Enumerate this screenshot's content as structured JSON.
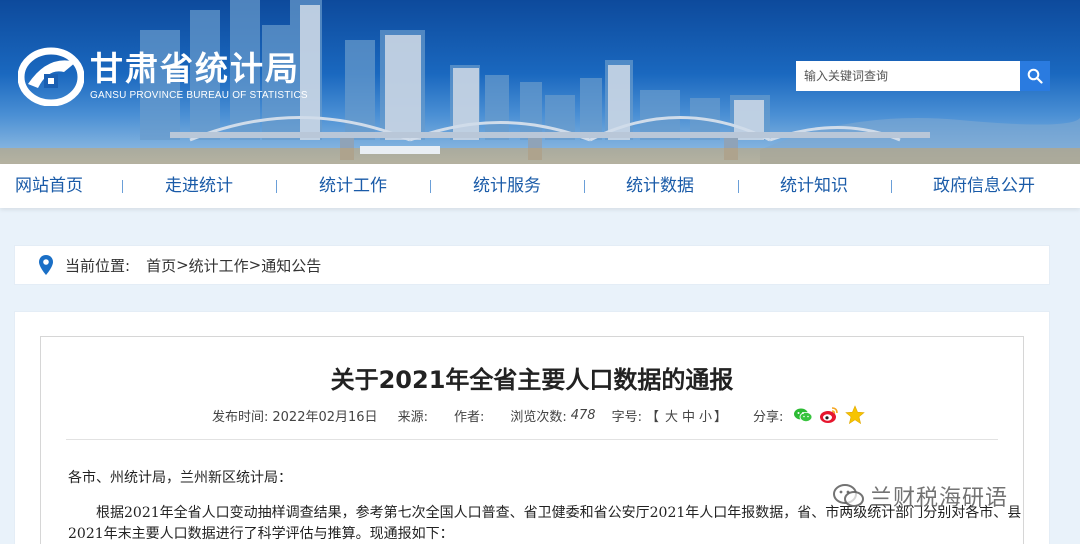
{
  "site": {
    "name_cn": "甘肃省统计局",
    "name_en": "GANSU PROVINCE BUREAU OF STATISTICS",
    "logo_icon": "gansu-stats-logo"
  },
  "search": {
    "placeholder": "输入关键词查询",
    "icon": "search-icon"
  },
  "nav": {
    "items": [
      {
        "label": "网站首页"
      },
      {
        "label": "走进统计"
      },
      {
        "label": "统计工作"
      },
      {
        "label": "统计服务"
      },
      {
        "label": "统计数据"
      },
      {
        "label": "统计知识"
      },
      {
        "label": "政府信息公开"
      }
    ],
    "separator": "|"
  },
  "breadcrumb": {
    "prefix": "当前位置:",
    "items": [
      "首页",
      "统计工作",
      "通知公告"
    ],
    "separator": ">"
  },
  "article": {
    "title": "关于2021年全省主要人口数据的通报",
    "meta": {
      "date_label": "发布时间:",
      "date_value": "2022年02月16日",
      "source_label": "来源:",
      "author_label": "作者:",
      "views_label": "浏览次数:",
      "views_value": "478",
      "font_label": "字号:",
      "font_open": "【",
      "font_large": "大",
      "font_medium": "中",
      "font_small": "小",
      "font_close": "】",
      "share_label": "分享:"
    },
    "paragraph1": "各市、州统计局，兰州新区统计局：",
    "paragraph2": "根据2021年全省人口变动抽样调查结果，参考第七次全国人口普查、省卫健委和省公安厅2021年人口年报数据，省、市两级统计部门分别对各市、县",
    "paragraph3": "2021年末主要人口数据进行了科学评估与推算。现通报如下："
  },
  "watermark": {
    "text": "兰财税海研语"
  },
  "colors": {
    "nav_text": "#1a5ba8",
    "banner_top": "#0d4a9c",
    "search_button": "#2a7be0"
  }
}
